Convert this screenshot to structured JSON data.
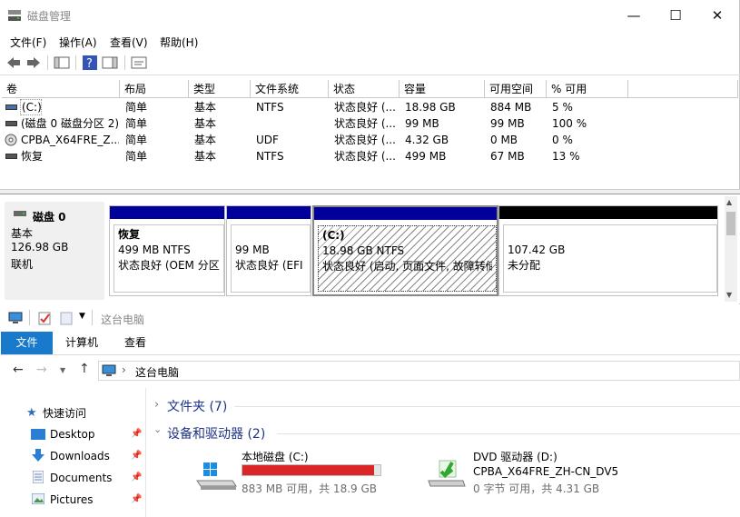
{
  "window": {
    "title": "磁盘管理"
  },
  "menu": [
    "文件(F)",
    "操作(A)",
    "查看(V)",
    "帮助(H)"
  ],
  "columns": [
    "卷",
    "布局",
    "类型",
    "文件系统",
    "状态",
    "容量",
    "可用空间",
    "% 可用"
  ],
  "volumes": [
    [
      "(C:)",
      "简单",
      "基本",
      "NTFS",
      "状态良好 (...",
      "18.98 GB",
      "884 MB",
      "5 %"
    ],
    [
      "(磁盘 0 磁盘分区 2)",
      "简单",
      "基本",
      "",
      "状态良好 (...",
      "99 MB",
      "99 MB",
      "100 %"
    ],
    [
      "CPBA_X64FRE_Z...",
      "简单",
      "基本",
      "UDF",
      "状态良好 (...",
      "4.32 GB",
      "0 MB",
      "0 %"
    ],
    [
      "恢复",
      "简单",
      "基本",
      "NTFS",
      "状态良好 (...",
      "499 MB",
      "67 MB",
      "13 %"
    ]
  ],
  "disk": {
    "name": "磁盘 0",
    "type": "基本",
    "size": "126.98 GB",
    "status": "联机",
    "partitions": [
      {
        "title": "恢复",
        "line1": "499 MB NTFS",
        "line2": "状态良好 (OEM 分区"
      },
      {
        "title": "",
        "line1": "99 MB",
        "line2": "状态良好 (EFI"
      },
      {
        "title": "(C:)",
        "line1": "18.98 GB NTFS",
        "line2": "状态良好 (启动, 页面文件, 故障转储"
      },
      {
        "title": "",
        "line1": "107.42 GB",
        "line2": "未分配"
      }
    ]
  },
  "explorer": {
    "title": "这台电脑",
    "tabs": [
      "文件",
      "计算机",
      "查看"
    ],
    "address": "这台电脑",
    "nav": {
      "quick_access": "快速访问",
      "items": [
        "Desktop",
        "Downloads",
        "Documents",
        "Pictures"
      ]
    },
    "folders_header": "文件夹 (7)",
    "devices_header": "设备和驱动器 (2)",
    "drives": [
      {
        "name": "本地磁盘 (C:)",
        "free": "883 MB 可用，共 18.9 GB",
        "used_fraction": 0.954
      },
      {
        "name": "DVD 驱动器 (D:)",
        "label": "CPBA_X64FRE_ZH-CN_DV5",
        "free": "0 字节 可用，共 4.31 GB"
      }
    ]
  },
  "colors": {
    "partition_bar": "#01009a",
    "unallocated_bar": "#000000",
    "drive_bar_full": "#da2626",
    "ribbon_active": "#1979ca"
  }
}
